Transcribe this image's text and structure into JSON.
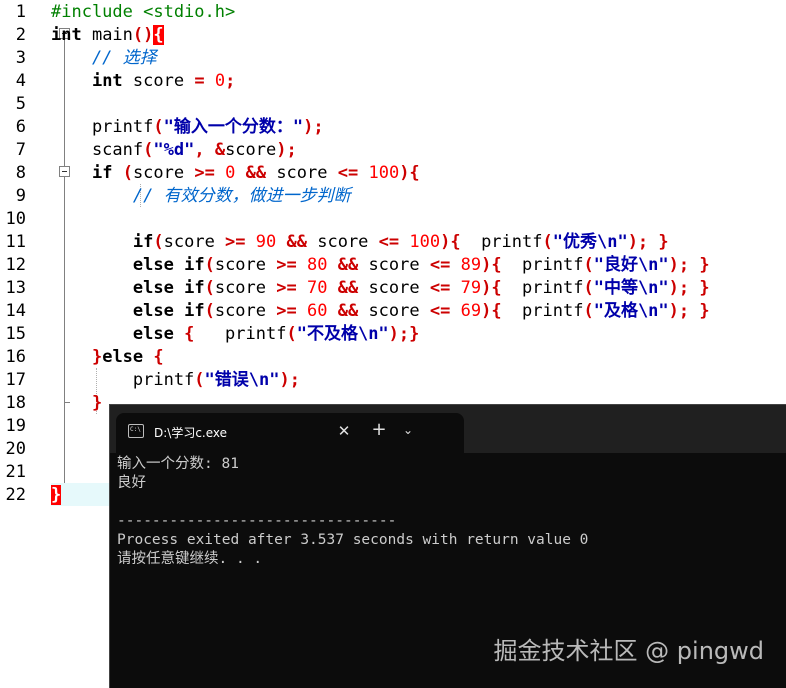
{
  "editor": {
    "line_numbers": [
      "1",
      "2",
      "3",
      "4",
      "5",
      "6",
      "7",
      "8",
      "9",
      "10",
      "11",
      "12",
      "13",
      "14",
      "15",
      "16",
      "17",
      "18",
      "19",
      "20",
      "21",
      "22"
    ],
    "lines": [
      {
        "segments": [
          {
            "t": "#include <stdio.h>",
            "c": "pp"
          }
        ]
      },
      {
        "segments": [
          {
            "t": "int",
            "c": "kw"
          },
          {
            "t": " main",
            "c": ""
          },
          {
            "t": "()",
            "c": "op"
          },
          {
            "t": "{",
            "c": "brace-hl"
          }
        ]
      },
      {
        "segments": [
          {
            "t": "    // 选择",
            "c": "cmt"
          }
        ]
      },
      {
        "segments": [
          {
            "t": "    ",
            "c": ""
          },
          {
            "t": "int",
            "c": "kw"
          },
          {
            "t": " score ",
            "c": ""
          },
          {
            "t": "=",
            "c": "op"
          },
          {
            "t": " ",
            "c": ""
          },
          {
            "t": "0",
            "c": "num"
          },
          {
            "t": ";",
            "c": "op"
          }
        ]
      },
      {
        "segments": []
      },
      {
        "segments": [
          {
            "t": "    printf",
            "c": ""
          },
          {
            "t": "(",
            "c": "op"
          },
          {
            "t": "\"输入一个分数：\"",
            "c": "str"
          },
          {
            "t": ");",
            "c": "op"
          }
        ]
      },
      {
        "segments": [
          {
            "t": "    scanf",
            "c": ""
          },
          {
            "t": "(",
            "c": "op"
          },
          {
            "t": "\"%d\"",
            "c": "str"
          },
          {
            "t": ", ",
            "c": "op"
          },
          {
            "t": "&",
            "c": "op"
          },
          {
            "t": "score",
            "c": ""
          },
          {
            "t": ");",
            "c": "op"
          }
        ]
      },
      {
        "segments": [
          {
            "t": "    ",
            "c": ""
          },
          {
            "t": "if",
            "c": "kw"
          },
          {
            "t": " ",
            "c": ""
          },
          {
            "t": "(",
            "c": "op"
          },
          {
            "t": "score ",
            "c": ""
          },
          {
            "t": ">=",
            "c": "op"
          },
          {
            "t": " ",
            "c": ""
          },
          {
            "t": "0",
            "c": "num"
          },
          {
            "t": " ",
            "c": ""
          },
          {
            "t": "&&",
            "c": "op"
          },
          {
            "t": " score ",
            "c": ""
          },
          {
            "t": "<=",
            "c": "op"
          },
          {
            "t": " ",
            "c": ""
          },
          {
            "t": "100",
            "c": "num"
          },
          {
            "t": "){",
            "c": "op"
          }
        ]
      },
      {
        "segments": [
          {
            "t": "        // 有效分数，做进一步判断",
            "c": "cmt"
          }
        ]
      },
      {
        "segments": []
      },
      {
        "segments": [
          {
            "t": "        ",
            "c": ""
          },
          {
            "t": "if",
            "c": "kw"
          },
          {
            "t": "(",
            "c": "op"
          },
          {
            "t": "score ",
            "c": ""
          },
          {
            "t": ">=",
            "c": "op"
          },
          {
            "t": " ",
            "c": ""
          },
          {
            "t": "90",
            "c": "num"
          },
          {
            "t": " ",
            "c": ""
          },
          {
            "t": "&&",
            "c": "op"
          },
          {
            "t": " score ",
            "c": ""
          },
          {
            "t": "<=",
            "c": "op"
          },
          {
            "t": " ",
            "c": ""
          },
          {
            "t": "100",
            "c": "num"
          },
          {
            "t": "){",
            "c": "op"
          },
          {
            "t": "  printf",
            "c": ""
          },
          {
            "t": "(",
            "c": "op"
          },
          {
            "t": "\"优秀\\n\"",
            "c": "str"
          },
          {
            "t": "); }",
            "c": "op"
          }
        ]
      },
      {
        "segments": [
          {
            "t": "        ",
            "c": ""
          },
          {
            "t": "else",
            "c": "kw"
          },
          {
            "t": " ",
            "c": ""
          },
          {
            "t": "if",
            "c": "kw"
          },
          {
            "t": "(",
            "c": "op"
          },
          {
            "t": "score ",
            "c": ""
          },
          {
            "t": ">=",
            "c": "op"
          },
          {
            "t": " ",
            "c": ""
          },
          {
            "t": "80",
            "c": "num"
          },
          {
            "t": " ",
            "c": ""
          },
          {
            "t": "&&",
            "c": "op"
          },
          {
            "t": " score ",
            "c": ""
          },
          {
            "t": "<=",
            "c": "op"
          },
          {
            "t": " ",
            "c": ""
          },
          {
            "t": "89",
            "c": "num"
          },
          {
            "t": "){",
            "c": "op"
          },
          {
            "t": "  printf",
            "c": ""
          },
          {
            "t": "(",
            "c": "op"
          },
          {
            "t": "\"良好\\n\"",
            "c": "str"
          },
          {
            "t": "); }",
            "c": "op"
          }
        ]
      },
      {
        "segments": [
          {
            "t": "        ",
            "c": ""
          },
          {
            "t": "else",
            "c": "kw"
          },
          {
            "t": " ",
            "c": ""
          },
          {
            "t": "if",
            "c": "kw"
          },
          {
            "t": "(",
            "c": "op"
          },
          {
            "t": "score ",
            "c": ""
          },
          {
            "t": ">=",
            "c": "op"
          },
          {
            "t": " ",
            "c": ""
          },
          {
            "t": "70",
            "c": "num"
          },
          {
            "t": " ",
            "c": ""
          },
          {
            "t": "&&",
            "c": "op"
          },
          {
            "t": " score ",
            "c": ""
          },
          {
            "t": "<=",
            "c": "op"
          },
          {
            "t": " ",
            "c": ""
          },
          {
            "t": "79",
            "c": "num"
          },
          {
            "t": "){",
            "c": "op"
          },
          {
            "t": "  printf",
            "c": ""
          },
          {
            "t": "(",
            "c": "op"
          },
          {
            "t": "\"中等\\n\"",
            "c": "str"
          },
          {
            "t": "); }",
            "c": "op"
          }
        ]
      },
      {
        "segments": [
          {
            "t": "        ",
            "c": ""
          },
          {
            "t": "else",
            "c": "kw"
          },
          {
            "t": " ",
            "c": ""
          },
          {
            "t": "if",
            "c": "kw"
          },
          {
            "t": "(",
            "c": "op"
          },
          {
            "t": "score ",
            "c": ""
          },
          {
            "t": ">=",
            "c": "op"
          },
          {
            "t": " ",
            "c": ""
          },
          {
            "t": "60",
            "c": "num"
          },
          {
            "t": " ",
            "c": ""
          },
          {
            "t": "&&",
            "c": "op"
          },
          {
            "t": " score ",
            "c": ""
          },
          {
            "t": "<=",
            "c": "op"
          },
          {
            "t": " ",
            "c": ""
          },
          {
            "t": "69",
            "c": "num"
          },
          {
            "t": "){",
            "c": "op"
          },
          {
            "t": "  printf",
            "c": ""
          },
          {
            "t": "(",
            "c": "op"
          },
          {
            "t": "\"及格\\n\"",
            "c": "str"
          },
          {
            "t": "); }",
            "c": "op"
          }
        ]
      },
      {
        "segments": [
          {
            "t": "        ",
            "c": ""
          },
          {
            "t": "else",
            "c": "kw"
          },
          {
            "t": " ",
            "c": ""
          },
          {
            "t": "{",
            "c": "op"
          },
          {
            "t": "   printf",
            "c": ""
          },
          {
            "t": "(",
            "c": "op"
          },
          {
            "t": "\"不及格\\n\"",
            "c": "str"
          },
          {
            "t": ");}",
            "c": "op"
          }
        ]
      },
      {
        "segments": [
          {
            "t": "    ",
            "c": ""
          },
          {
            "t": "}",
            "c": "op"
          },
          {
            "t": "else",
            "c": "kw"
          },
          {
            "t": " ",
            "c": ""
          },
          {
            "t": "{",
            "c": "op"
          }
        ]
      },
      {
        "segments": [
          {
            "t": "        printf",
            "c": ""
          },
          {
            "t": "(",
            "c": "op"
          },
          {
            "t": "\"错误\\n\"",
            "c": "str"
          },
          {
            "t": ");",
            "c": "op"
          }
        ]
      },
      {
        "segments": [
          {
            "t": "    ",
            "c": ""
          },
          {
            "t": "}",
            "c": "op"
          }
        ]
      },
      {
        "segments": []
      },
      {
        "segments": []
      },
      {
        "segments": []
      },
      {
        "segments": [
          {
            "t": "}",
            "c": "brace-hl"
          }
        ]
      }
    ]
  },
  "terminal": {
    "tab_title": "D:\\学习c.exe",
    "close_glyph": "✕",
    "new_tab_glyph": "+",
    "dropdown_glyph": "⌄",
    "output_lines": [
      "输入一个分数: 81",
      "良好",
      "",
      "--------------------------------",
      "Process exited after 3.537 seconds with return value 0",
      "请按任意键继续. . ."
    ],
    "colors": {
      "background": "#0c0c0c",
      "titlebar": "#202020",
      "text": "#cccccc"
    }
  },
  "watermark": "掘金技术社区 @ pingwd"
}
